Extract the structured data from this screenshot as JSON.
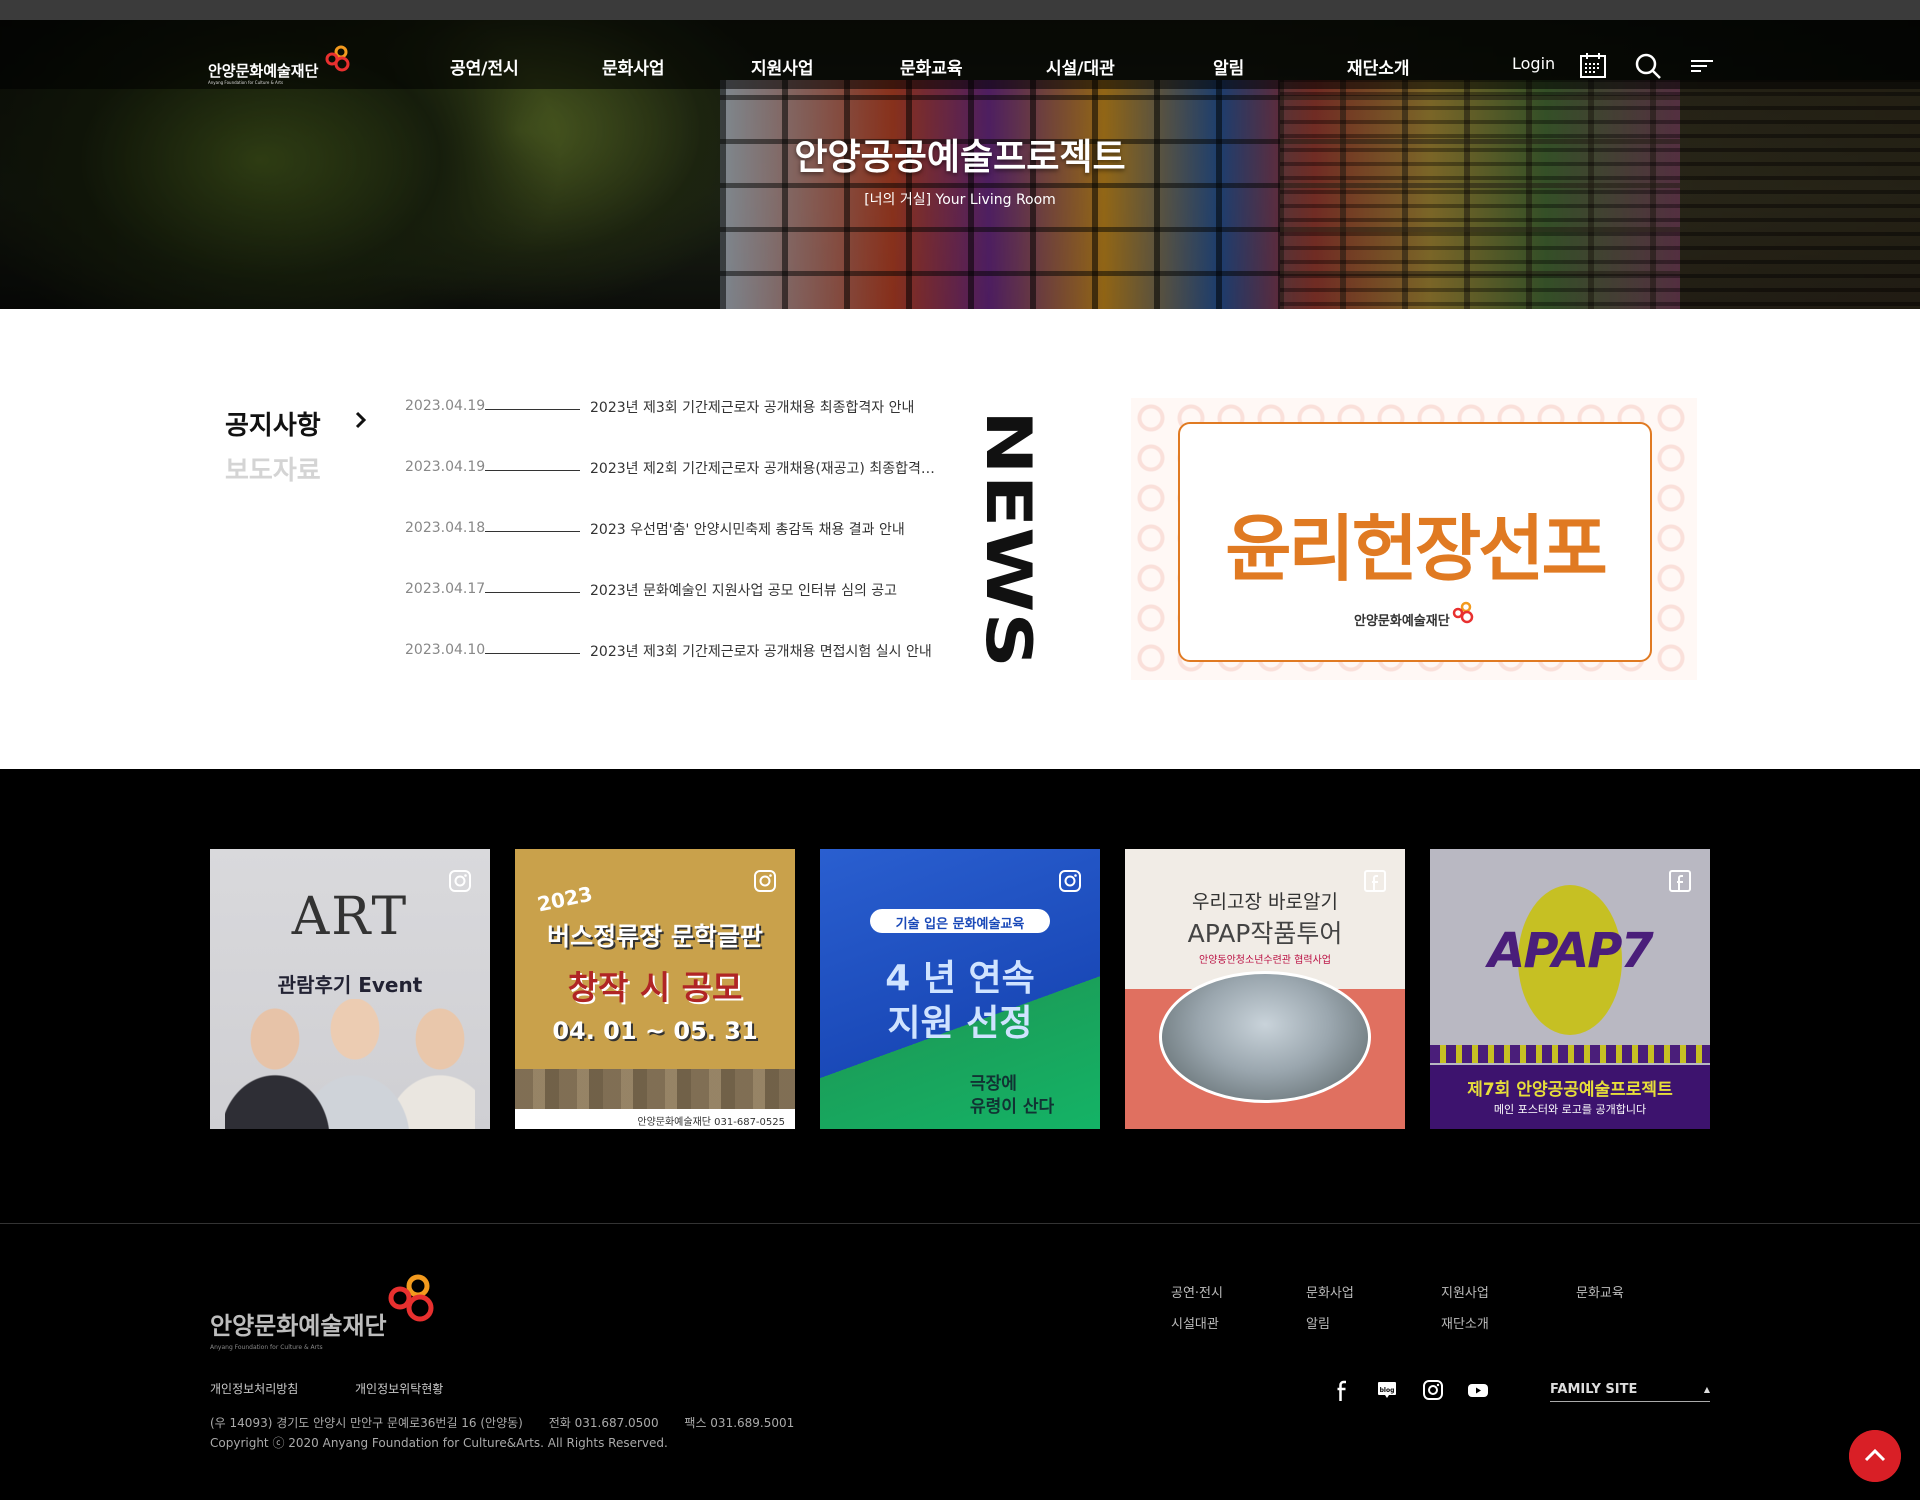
{
  "header": {
    "logo_text": "안양문화예술재단",
    "logo_subtext": "Anyang Foundation for Culture & Arts",
    "menu": [
      "공연/전시",
      "문화사업",
      "지원사업",
      "문화교육",
      "시설/대관",
      "알림",
      "재단소개"
    ],
    "login_label": "Login",
    "icons": [
      "calendar-icon",
      "search-icon",
      "hamburger-menu-icon"
    ]
  },
  "hero": {
    "title": "안양공공예술프로젝트",
    "subtitle": "[너의 거실] Your Living Room"
  },
  "news": {
    "tabs": [
      "공지사항",
      "보도자료"
    ],
    "active_tab": "공지사항",
    "section_word": "NEWS",
    "items": [
      {
        "date": "2023.04.19",
        "title": "2023년 제3회 기간제근로자 공개채용 최종합격자 안내"
      },
      {
        "date": "2023.04.19",
        "title": "2023년 제2회 기간제근로자 공개채용(재공고) 최종합격자 ..."
      },
      {
        "date": "2023.04.18",
        "title": "2023 우선멈'춤' 안양시민축제 총감독 채용 결과 안내"
      },
      {
        "date": "2023.04.17",
        "title": "2023년 문화예술인 지원사업 공모 인터뷰 심의 공고"
      },
      {
        "date": "2023.04.10",
        "title": "2023년 제3회 기간제근로자 공개채용 면접시험 실시 안내"
      }
    ],
    "banner": {
      "headline": "윤리헌장선포",
      "org": "안양문화예술재단"
    }
  },
  "sns": {
    "cards": [
      {
        "platform": "instagram-icon",
        "headline": "ART",
        "sub": "관람후기 Event"
      },
      {
        "platform": "instagram-icon",
        "year": "2023",
        "line1": "버스정류장 문학글판",
        "line2": "창작 시 공모",
        "line3": "04. 01 ~ 05. 31",
        "footer": "안양문화예술재단 031-687-0525"
      },
      {
        "platform": "instagram-icon",
        "pill": "기술 입은 문화예술교육",
        "big1": "4 년 연속",
        "big2": "지원 선정",
        "sub1": "극장에",
        "sub2": "유령이 산다"
      },
      {
        "platform": "facebook-icon",
        "line1": "우리고장 바로알기",
        "line2": "APAP작품투어",
        "line3": "안양동안청소년수련관 협력사업"
      },
      {
        "platform": "facebook-icon",
        "logo": "APAP7",
        "bar1": "제7회 안양공공예술프로젝트",
        "bar2": "메인 포스터와 로고를 공개합니다"
      }
    ]
  },
  "footer": {
    "logo_text": "안양문화예술재단",
    "logo_subtext": "Anyang Foundation for Culture & Arts",
    "links": [
      "개인정보처리방침",
      "개인정보위탁현황"
    ],
    "address": "(우 14093) 경기도 안양시 만안구 문예로36번길 16 (안양동)",
    "phone": "전화 031.687.0500",
    "fax": "팩스 031.689.5001",
    "copyright": "Copyright ⓒ 2020 Anyang Foundation for Culture&Arts. All Rights Reserved.",
    "menu": [
      "공연·전시",
      "문화사업",
      "지원사업",
      "문화교육",
      "시설대관",
      "알림",
      "재단소개"
    ],
    "social_icons": [
      "facebook-icon",
      "blog-icon",
      "instagram-icon",
      "youtube-icon"
    ],
    "family_site_label": "FAMILY SITE",
    "family_site_arrow": "▲"
  },
  "colors": {
    "accent_red": "#d91f26",
    "ethics_orange": "#e07a22"
  }
}
